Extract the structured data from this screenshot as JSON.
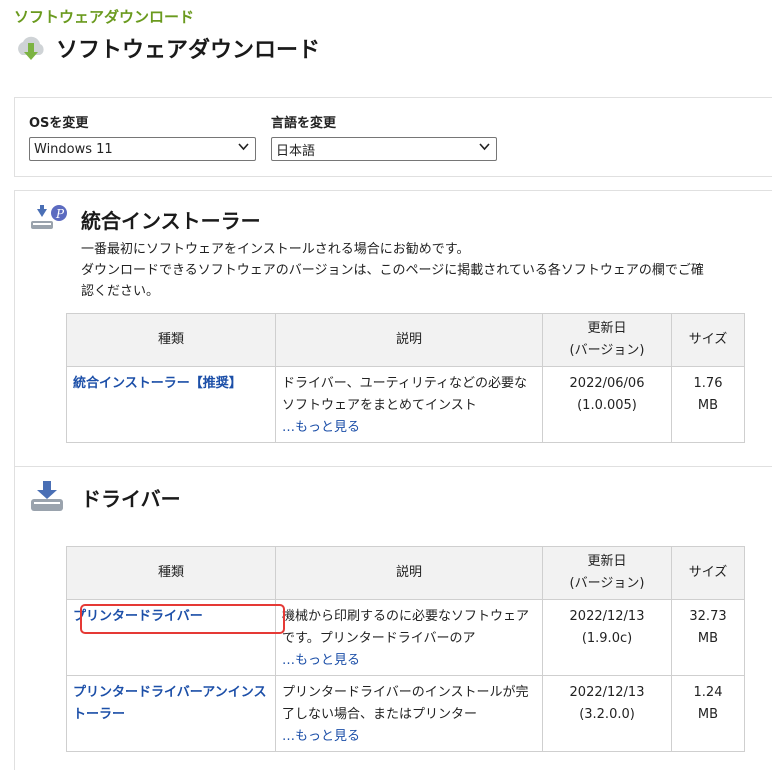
{
  "breadcrumb": "ソフトウェアダウンロード",
  "page_title": "ソフトウェアダウンロード",
  "selectors": {
    "os_label": "OSを変更",
    "os_value": "Windows 11",
    "lang_label": "言語を変更",
    "lang_value": "日本語"
  },
  "integrated": {
    "title": "統合インストーラー",
    "desc1": "一番最初にソフトウェアをインストールされる場合にお勧めです。",
    "desc2": "ダウンロードできるソフトウェアのバージョンは、このページに掲載されている各ソフトウェアの欄でご確",
    "desc3": "認ください。",
    "headers": {
      "type": "種類",
      "desc": "説明",
      "updated1": "更新日",
      "updated2": "(バージョン)",
      "size": "サイズ"
    },
    "rows": [
      {
        "name": "統合インストーラー【推奨】",
        "desc": "ドライバー、ユーティリティなどの必要なソフトウェアをまとめてインスト",
        "more": "…もっと見る",
        "date": "2022/06/06",
        "version": "(1.0.005)",
        "size_num": "1.76",
        "size_unit": "MB"
      }
    ]
  },
  "driver": {
    "title": "ドライバー",
    "headers": {
      "type": "種類",
      "desc": "説明",
      "updated1": "更新日",
      "updated2": "(バージョン)",
      "size": "サイズ"
    },
    "rows": [
      {
        "name": "プリンタードライバー",
        "desc": "機械から印刷するのに必要なソフトウェアです。プリンタードライバーのア",
        "more": "…もっと見る",
        "date": "2022/12/13",
        "version": "(1.9.0c)",
        "size_num": "32.73",
        "size_unit": "MB"
      },
      {
        "name": "プリンタードライバーアンインストーラー",
        "desc": "プリンタードライバーのインストールが完了しない場合、またはプリンター",
        "more": "…もっと見る",
        "date": "2022/12/13",
        "version": "(3.2.0.0)",
        "size_num": "1.24",
        "size_unit": "MB"
      }
    ]
  },
  "colors": {
    "breadcrumb": "#6a9a1e",
    "link": "#1c4fa8",
    "highlight": "#e53935"
  }
}
